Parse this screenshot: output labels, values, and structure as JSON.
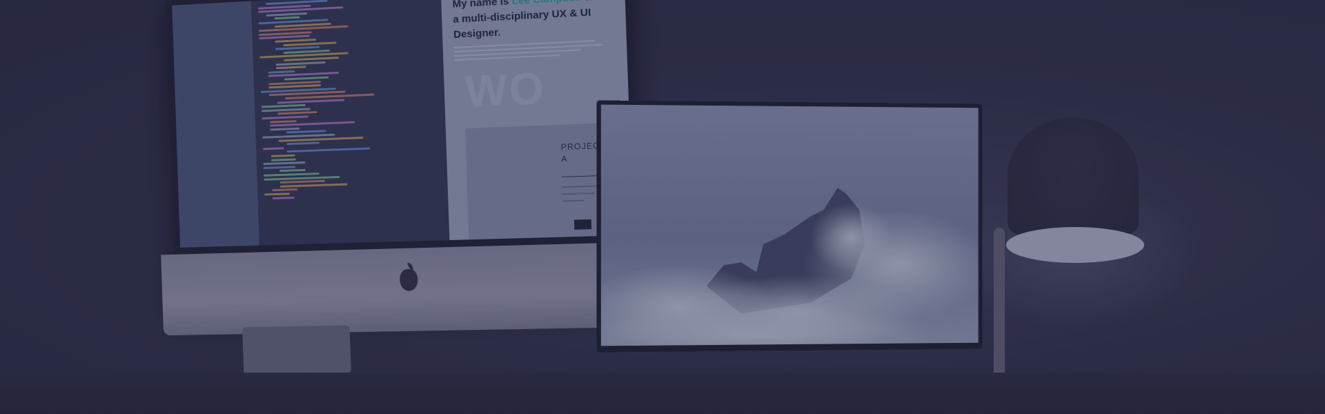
{
  "preview": {
    "intro_prefix": "My name is ",
    "intro_name": "Lee Campbell",
    "intro_suffix": " & I'm a multi-disciplinary UX & UI Designer.",
    "ghost_word": "WO",
    "project_title": "PROJECT A"
  },
  "colors": {
    "background": "#2b2c42",
    "name_accent": "#2a8f93",
    "overlay_tint": "#28284a"
  },
  "icons": {
    "brand_logo": "apple-logo-icon"
  }
}
